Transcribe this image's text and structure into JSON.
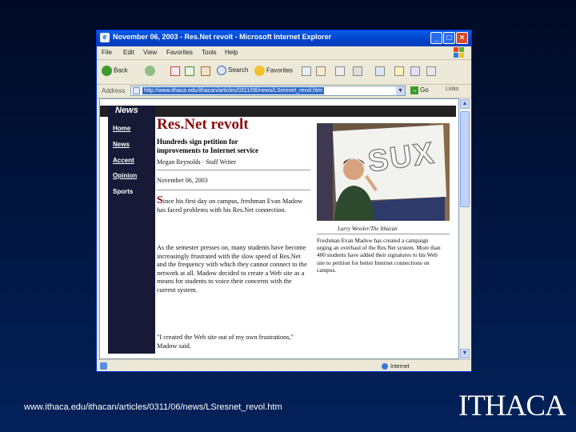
{
  "browser": {
    "title": "November 06, 2003 - Res.Net revolt - Microsoft Internet Explorer",
    "menu": [
      "File",
      "Edit",
      "View",
      "Favorites",
      "Tools",
      "Help"
    ],
    "toolbar": {
      "back": "Back",
      "search": "Search",
      "favorites": "Favorites"
    },
    "address_label": "Address",
    "address_value": "http://www.ithaca.edu/ithacan/articles/0311/06/news/LSresnet_revol.htm",
    "go_label": "Go",
    "links_label": "Links",
    "status_zone": "Internet"
  },
  "page": {
    "section": "News",
    "nav": [
      "Home",
      "News",
      "Accent",
      "Opinion",
      "Sports"
    ],
    "headline": "Res.Net revolt",
    "subhead": "Hundreds sign petition for improvements to Internet service",
    "byline": "Megan Reynolds · Staff Writer",
    "date": "November 06, 2003",
    "dropcap": "S",
    "para1": "ince his first day on campus, freshman Evan Madow has faced problems with his Res.Net connection.",
    "para2": "As the semester presses on, many students have become increasingly frustrated with the slow speed of Res.Net and the frequency with which they cannot connect to the network at all. Madow decided to create a Web site as a means for students to voice their concerns with the current system.",
    "para3": "\"I created the Web site out of my own frustrations,\" Madow said.",
    "photo_sign": "SUX",
    "photo_credit": "Larry Wessler/The Ithacan",
    "caption": "Freshman Evan Madow has created a campaign urging an overhaul of the Res.Net system. More than 400 students have added their signatures to his Web site to petition for better Internet connections on campus."
  },
  "slide": {
    "url": "www.ithaca.edu/ithacan/articles/0311/06/news/LSresnet_revol.htm",
    "logo": "ITHACA"
  }
}
